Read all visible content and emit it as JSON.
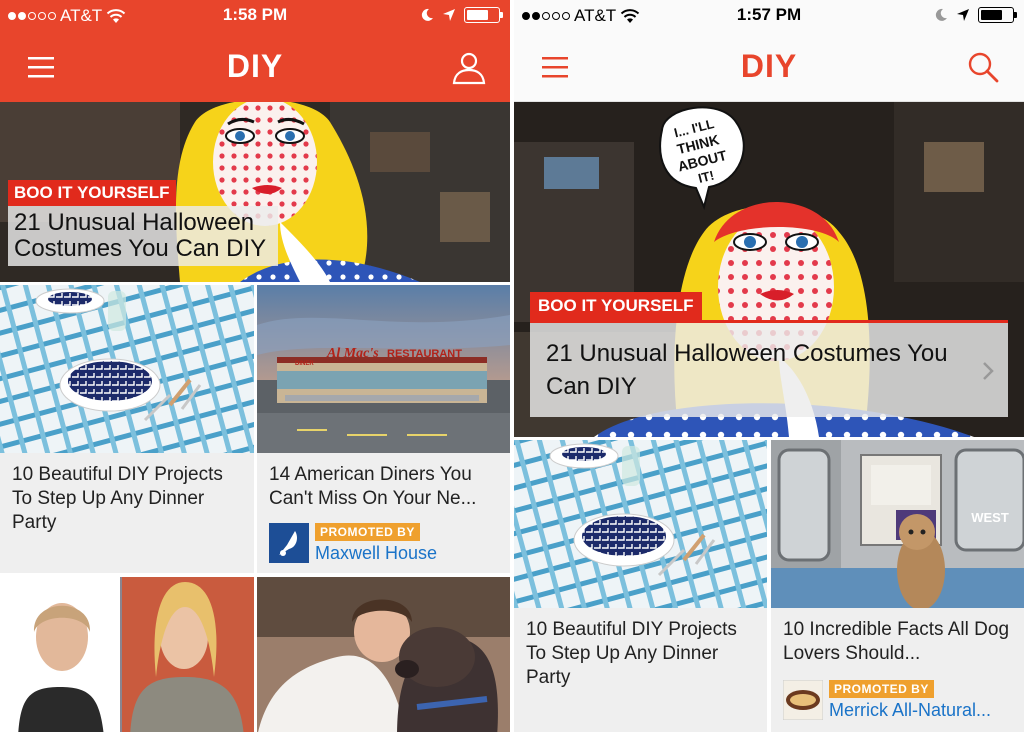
{
  "colors": {
    "brand_red": "#e8452c",
    "tag_red": "#e12a1c",
    "promo_orange": "#efa02e",
    "link_blue": "#1a73c8"
  },
  "left": {
    "status": {
      "carrier": "AT&T",
      "time": "1:58 PM"
    },
    "nav": {
      "title": "DIY",
      "left_icon": "hamburger-icon",
      "right_icon": "user-icon"
    },
    "hero": {
      "tag": "BOO IT YOURSELF",
      "title": "21 Unusual Halloween Costumes You Can DIY"
    },
    "cards": [
      {
        "title": "10 Beautiful DIY Projects To Step Up Any Dinner Party"
      },
      {
        "title": "14 American Diners You Can't Miss On Your Ne...",
        "promo_label": "PROMOTED BY",
        "sponsor": "Maxwell House",
        "sign_left": "Al Mac's",
        "sign_right": "RESTAURANT",
        "sign_small": "DINER"
      }
    ]
  },
  "right": {
    "status": {
      "carrier": "AT&T",
      "time": "1:57 PM"
    },
    "nav": {
      "title": "DIY",
      "left_icon": "hamburger-icon",
      "right_icon": "search-icon"
    },
    "hero": {
      "tag": "BOO IT YOURSELF",
      "title": "21 Unusual Halloween Costumes You Can DIY",
      "speech": [
        "I... I'LL",
        "THINK",
        "ABOUT",
        "IT!"
      ]
    },
    "cards": [
      {
        "title": "10 Beautiful DIY Projects To Step Up Any Dinner Party"
      },
      {
        "title": "10 Incredible Facts All Dog Lovers Should...",
        "promo_label": "PROMOTED BY",
        "sponsor": "Merrick All-Natural...",
        "subway_sign": "WEST"
      }
    ]
  }
}
